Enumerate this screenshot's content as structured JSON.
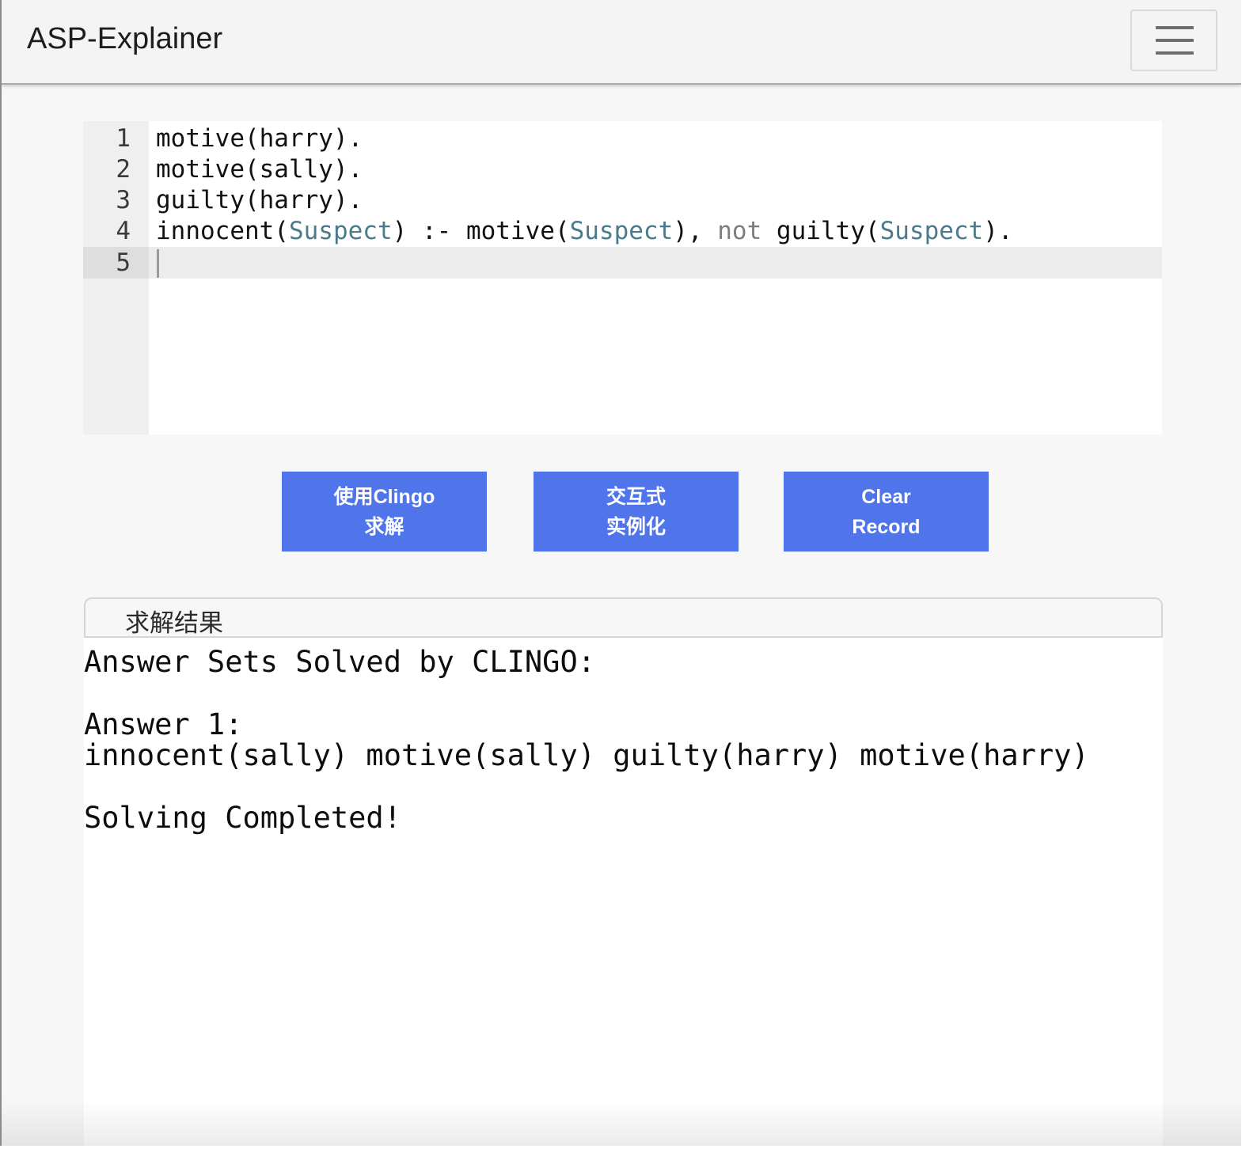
{
  "app": {
    "title": "ASP-Explainer"
  },
  "navbar": {
    "menu_icon": "hamburger-menu-icon"
  },
  "editor": {
    "lines": [
      {
        "num": "1",
        "segments": [
          {
            "t": "motive(harry).",
            "k": "plain"
          }
        ]
      },
      {
        "num": "2",
        "segments": [
          {
            "t": "motive(sally).",
            "k": "plain"
          }
        ]
      },
      {
        "num": "3",
        "segments": [
          {
            "t": "guilty(harry).",
            "k": "plain"
          }
        ]
      },
      {
        "num": "4",
        "segments": [
          {
            "t": "innocent(",
            "k": "plain"
          },
          {
            "t": "Suspect",
            "k": "var"
          },
          {
            "t": ") :- motive(",
            "k": "plain"
          },
          {
            "t": "Suspect",
            "k": "var"
          },
          {
            "t": "), ",
            "k": "plain"
          },
          {
            "t": "not",
            "k": "kw"
          },
          {
            "t": " guilty(",
            "k": "plain"
          },
          {
            "t": "Suspect",
            "k": "var"
          },
          {
            "t": ").",
            "k": "plain"
          }
        ]
      },
      {
        "num": "5",
        "segments": []
      }
    ],
    "active_line": "5",
    "colors": {
      "variable": "#4a7b8a",
      "keyword": "#7d7d7d"
    }
  },
  "buttons": {
    "solve": {
      "line1": "使用Clingo",
      "line2": "求解"
    },
    "interactive": {
      "line1": "交互式",
      "line2": "实例化"
    },
    "clear": {
      "line1": "Clear",
      "line2": "Record"
    },
    "color": "#5074ea"
  },
  "result": {
    "header": "求解结果",
    "lines": [
      "Answer Sets Solved by CLINGO:",
      "",
      "Answer 1:",
      "innocent(sally) motive(sally) guilty(harry) motive(harry)",
      "",
      "Solving Completed!"
    ]
  }
}
